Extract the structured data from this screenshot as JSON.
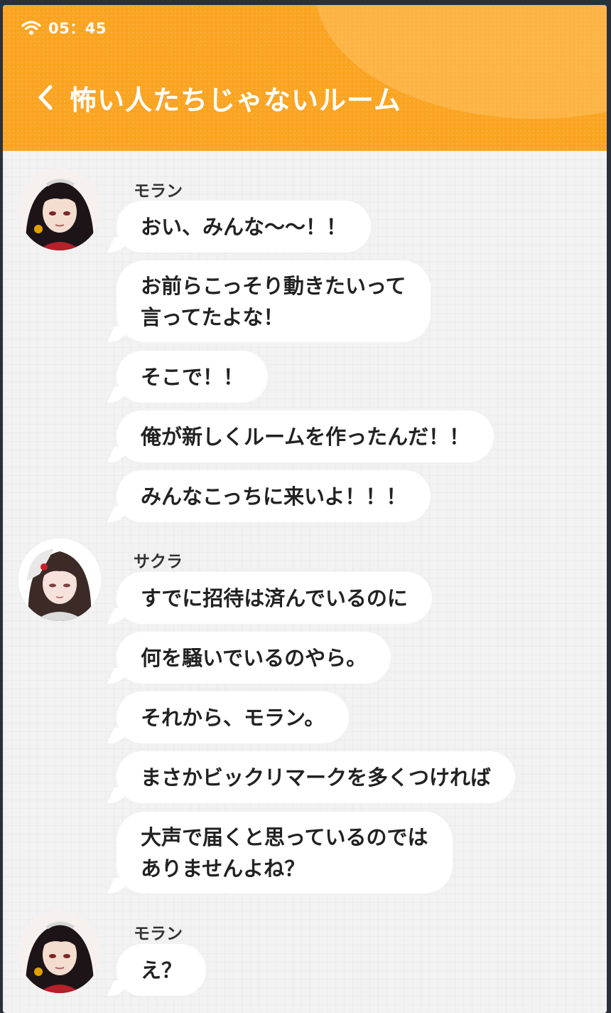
{
  "status": {
    "time": "05：45"
  },
  "header": {
    "title": "怖い人たちじゃないルーム"
  },
  "messages": [
    {
      "sender": "モラン",
      "lines": [
        "おい、みんな～～！！",
        "お前らこっそり動きたいって\n言ってたよな！",
        "そこで！！",
        "俺が新しくルームを作ったんだ！！",
        "みんなこっちに来いよ！！！"
      ]
    },
    {
      "sender": "サクラ",
      "lines": [
        "すでに招待は済んでいるのに",
        "何を騒いでいるのやら。",
        "それから、モラン。",
        "まさかビックリマークを多くつければ",
        "大声で届くと思っているのでは\nありませんよね？"
      ]
    },
    {
      "sender": "モラン",
      "lines": [
        "え？"
      ]
    }
  ],
  "colors": {
    "header": "#fba422",
    "background": "#f2f2f2",
    "bubble": "#ffffff",
    "text": "#222222"
  },
  "icons": {
    "wifi": "wifi-icon",
    "back": "chevron-left-icon"
  }
}
